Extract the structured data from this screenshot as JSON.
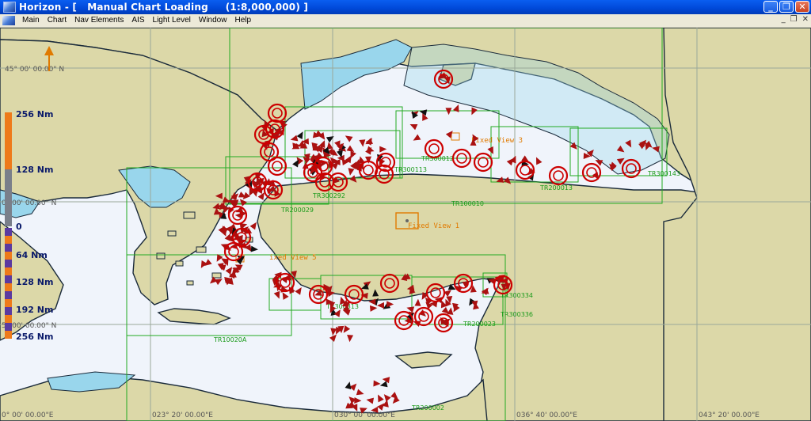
{
  "window": {
    "title": "Horizon - [   Manual Chart Loading     (1:8,000,000) ]",
    "minimize_glyph": "_",
    "restore_glyph": "❐",
    "close_glyph": "✕"
  },
  "menu": {
    "items": [
      "Main",
      "Chart",
      "Nav Elements",
      "AIS",
      "Light Level",
      "Window",
      "Help"
    ],
    "mdi_min": "_",
    "mdi_restore": "❐",
    "mdi_close": "✕"
  },
  "map": {
    "lat_labels": [
      "45° 00' 00.00\" N",
      "0° 00' 00.00\" N",
      "5° 00' 00.00\" N"
    ],
    "lon_labels": [
      "0° 00' 00.00\"E",
      "023° 20' 00.00\"E",
      "030° 00' 00.00\"E",
      "036° 40' 00.00\"E",
      "043° 20' 00.00\"E"
    ],
    "north_arrow": "N",
    "fixed_views": [
      "Fixed View 1",
      "Fixed View 3",
      "ixed View 5"
    ],
    "tile_labels": [
      "TR300113",
      "TR300143",
      "TR300012",
      "TR100010",
      "TR200013",
      "TR200029",
      "TR300292",
      "TR300313",
      "TR300334",
      "TR300336",
      "TR200023",
      "TR10020A",
      "TR200002"
    ],
    "colors": {
      "sea": "#f0f4fb",
      "land": "#dcd8a8",
      "shallow": "#99d6ec",
      "grid": "#22aa22",
      "target": "#cc0000",
      "track_red": "#aa1111",
      "fixed_view": "#e07a00"
    }
  },
  "scale": {
    "top_labels": [
      "256 Nm",
      "128 Nm",
      "0"
    ],
    "bottom_labels": [
      "64 Nm",
      "128 Nm",
      "192 Nm",
      "256 Nm"
    ]
  }
}
